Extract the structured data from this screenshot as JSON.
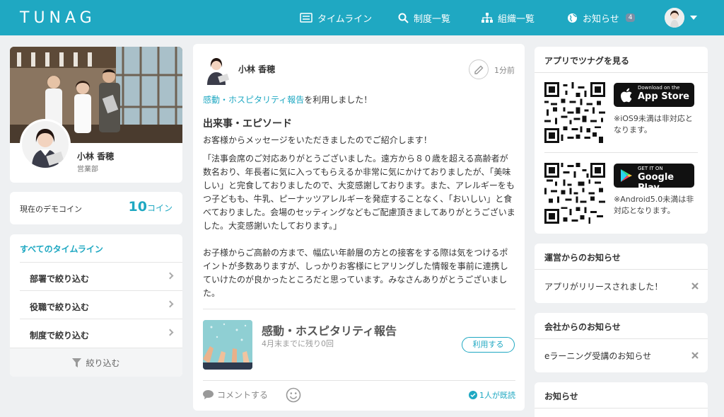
{
  "header": {
    "logo": "TUNAG",
    "nav": [
      {
        "label": "タイムライン",
        "icon": "timeline-icon"
      },
      {
        "label": "制度一覧",
        "icon": "search-icon"
      },
      {
        "label": "組織一覧",
        "icon": "org-chart-icon"
      },
      {
        "label": "お知らせ",
        "icon": "globe-icon",
        "badge": "4"
      }
    ],
    "brand_color": "#1fa8c2"
  },
  "profile": {
    "name": "小林 香穂",
    "department": "営業部"
  },
  "coins": {
    "label": "現在のデモコイン",
    "value": "10",
    "unit": "コイン"
  },
  "timeline_menu": {
    "title": "すべてのタイムライン",
    "items": [
      "部署で絞り込む",
      "役職で絞り込む",
      "制度で絞り込む"
    ],
    "filter_label": "絞り込む"
  },
  "post": {
    "author": "小林 香穂",
    "time": "1分前",
    "used_link": "感動・ホスピタリティ報告",
    "used_suffix": "を利用しました！",
    "heading": "出来事・エピソード",
    "para1": "お客様からメッセージをいただきましたのでご紹介します！",
    "para2": "「法事会席のご対応ありがとうございました。遠方から８０歳を超える高齢者が数名おり、年長者に気に入ってもらえるか非常に気にかけておりましたが、「美味しい」と完食しておりましたので、大変感謝しております。また、アレルギーをもつ子どもも、牛乳、ピーナッツアレルギーを発症することなく、「おいしい」と食べておりました。会場のセッティングなどもご配慮頂きましてありがとうございました。大変感謝いたしております。」",
    "para3": "お子様からご高齢の方まで、幅広い年齢層の方との接客をする際は気をつけるポイントが多数ありますが、しっかりお客様にヒアリングした情報を事前に連携していけたのが良かったところだと思っています。みなさんありがとうございました。",
    "link_card": {
      "title": "感動・ホスピタリティ報告",
      "remaining": "4月末までに残り0回",
      "button": "利用する"
    },
    "comment_label": "コメントする",
    "read_label": "1人が既読"
  },
  "app_card": {
    "title": "アプリでツナグを見る",
    "ios": {
      "small": "Download on the",
      "big": "App Store",
      "note": "※iOS9未満は非対応となります。"
    },
    "android": {
      "small": "GET IT ON",
      "big": "Google Play",
      "note": "※Android5.0未満は非対応となります。"
    }
  },
  "notices": [
    {
      "title": "運営からのお知らせ",
      "item": "アプリがリリースされました！"
    },
    {
      "title": "会社からのお知らせ",
      "item": "eラーニング受講のお知らせ"
    },
    {
      "title": "お知らせ"
    }
  ]
}
